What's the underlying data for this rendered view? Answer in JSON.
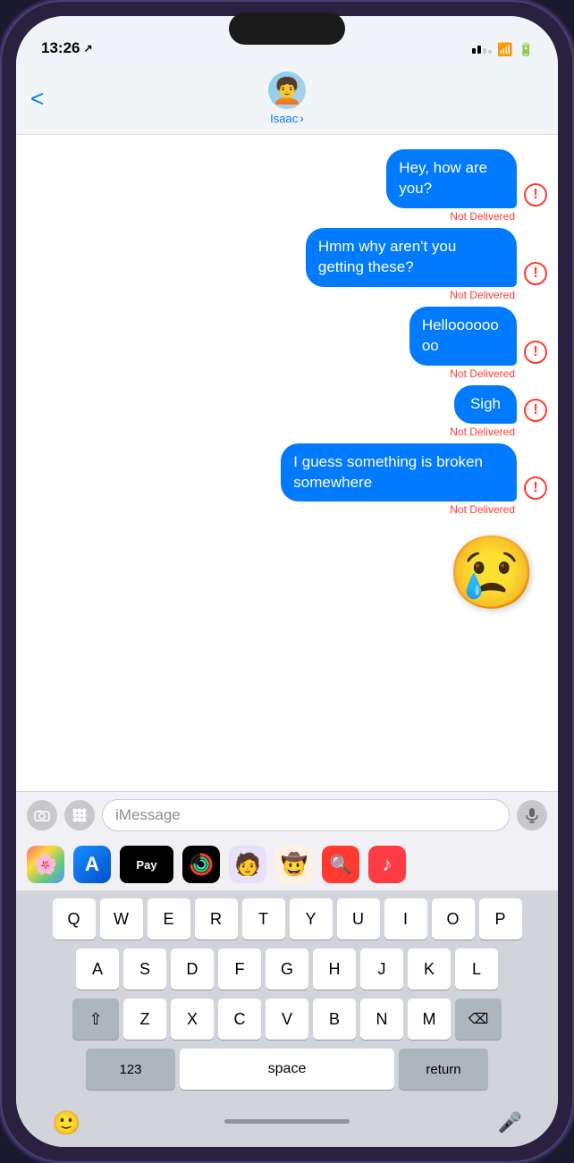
{
  "status": {
    "time": "13:26",
    "location_icon": "↗"
  },
  "nav": {
    "back_label": "<",
    "contact_name": "Isaac",
    "contact_chevron": "›"
  },
  "messages": [
    {
      "id": "msg1",
      "text": "Hey, how are you?",
      "type": "outgoing",
      "error": true,
      "not_delivered": "Not Delivered"
    },
    {
      "id": "msg2",
      "text": "Hmm why aren't you getting these?",
      "type": "outgoing",
      "error": true,
      "not_delivered": "Not Delivered"
    },
    {
      "id": "msg3",
      "text": "Helloooooooo",
      "type": "outgoing",
      "error": true,
      "not_delivered": "Not Delivered"
    },
    {
      "id": "msg4",
      "text": "Sigh",
      "type": "outgoing",
      "error": true,
      "not_delivered": "Not Delivered"
    },
    {
      "id": "msg5",
      "text": "I guess something is broken somewhere",
      "type": "outgoing",
      "error": true,
      "not_delivered": "Not Delivered"
    }
  ],
  "input": {
    "placeholder": "iMessage"
  },
  "keyboard": {
    "rows": [
      [
        "Q",
        "W",
        "E",
        "R",
        "T",
        "Y",
        "U",
        "I",
        "O",
        "P"
      ],
      [
        "A",
        "S",
        "D",
        "F",
        "G",
        "H",
        "J",
        "K",
        "L"
      ],
      [
        "Z",
        "X",
        "C",
        "V",
        "B",
        "N",
        "M"
      ]
    ],
    "num_label": "123",
    "space_label": "space",
    "return_label": "return"
  },
  "apps": [
    {
      "name": "photos",
      "emoji": "🌸"
    },
    {
      "name": "app-store",
      "emoji": "🅰️"
    },
    {
      "name": "apple-pay",
      "label": "Pay"
    },
    {
      "name": "activity",
      "emoji": "⬤"
    },
    {
      "name": "memoji",
      "emoji": "🧑"
    },
    {
      "name": "stickers",
      "emoji": "🤠"
    },
    {
      "name": "web",
      "emoji": "🔍"
    },
    {
      "name": "music",
      "emoji": "♪"
    }
  ]
}
